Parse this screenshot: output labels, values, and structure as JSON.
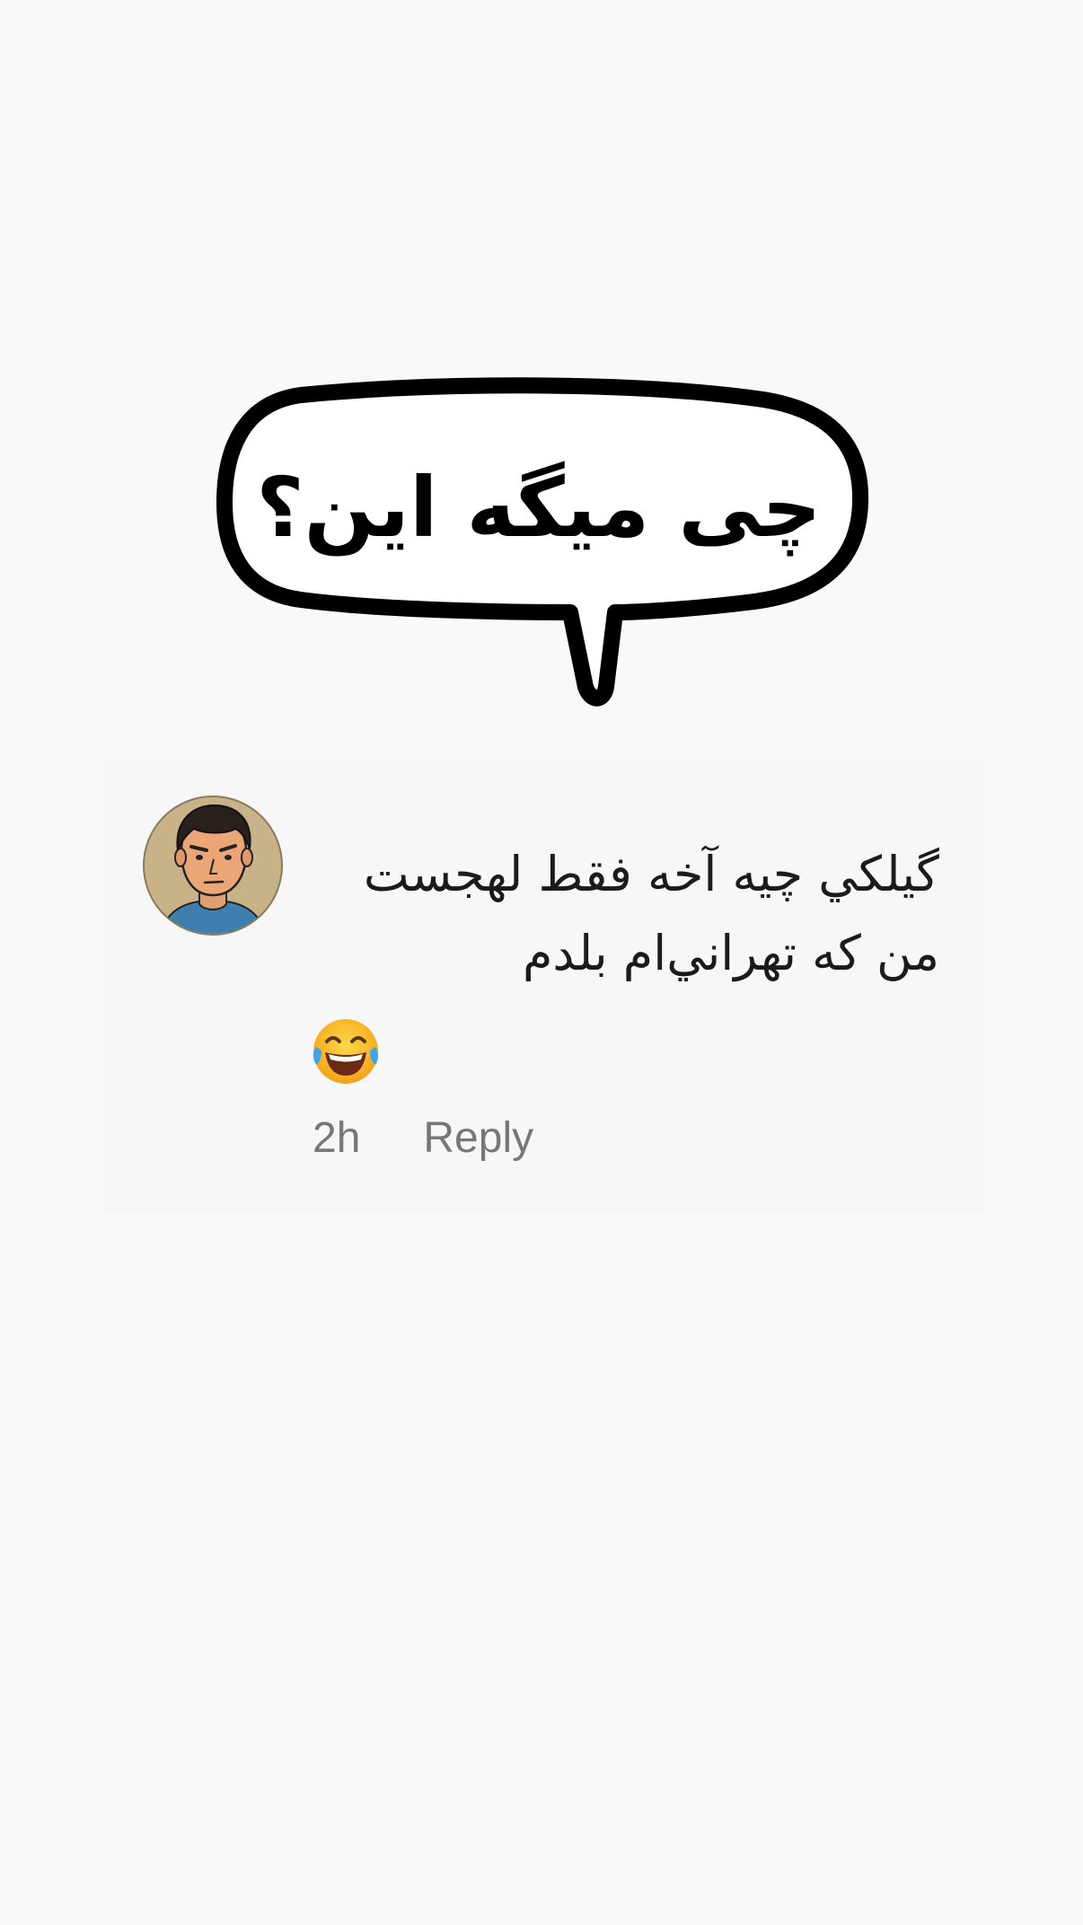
{
  "bubble": {
    "text": "چی میگه این؟"
  },
  "comment": {
    "avatar": "man-avatar-icon",
    "lines": [
      "گیلکي چیه آخه فقط لهجست",
      "من که تهراني‌ام بلدم"
    ],
    "emoji": "face-with-tears-of-joy-icon",
    "time": "2h",
    "reply_label": "Reply"
  }
}
